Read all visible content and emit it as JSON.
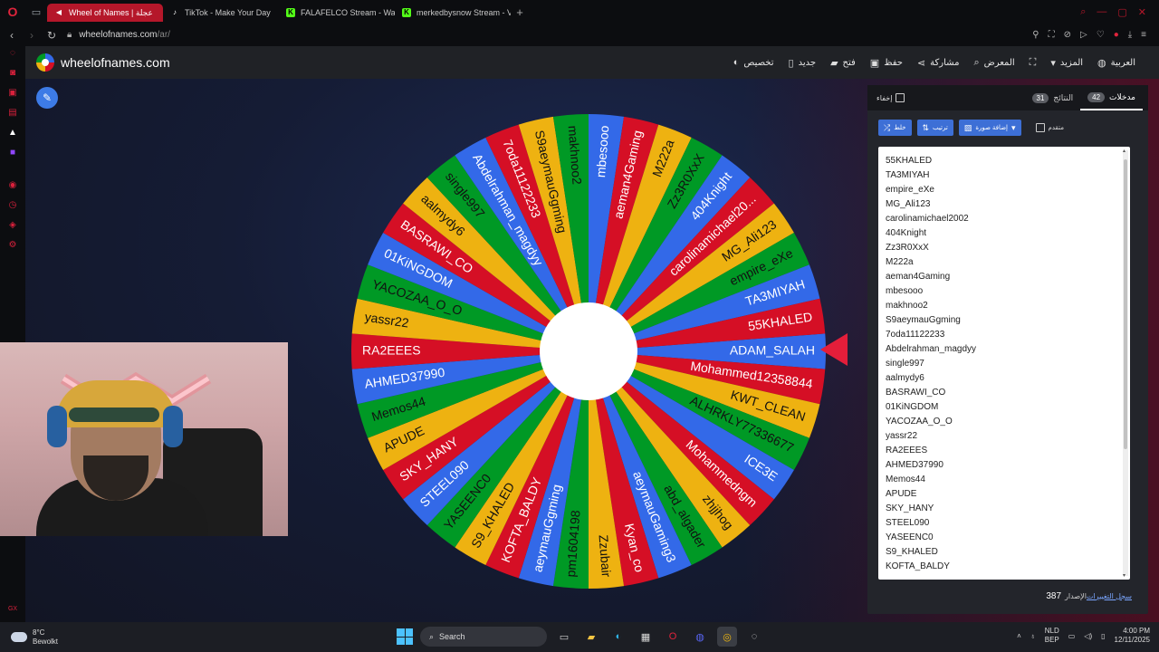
{
  "browser": {
    "tabs": [
      {
        "label": "Wheel of Names | عجلة",
        "active": true
      },
      {
        "label": "TikTok - Make Your Day",
        "active": false
      },
      {
        "label": "FALAFELCO Stream - Wa",
        "active": false
      },
      {
        "label": "merkedbysnow Stream - V",
        "active": false
      }
    ],
    "url_host": "wheelofnames.com",
    "url_path": "/ar/"
  },
  "site": {
    "brand": "wheelofnames.com",
    "menu": [
      {
        "label": "العربية",
        "icon": "globe-icon"
      },
      {
        "label": "المزيد",
        "icon": "caret-down-icon"
      },
      {
        "label": "",
        "icon": "fullscreen-icon"
      },
      {
        "label": "المعرض",
        "icon": "search-icon"
      },
      {
        "label": "مشاركة",
        "icon": "share-icon"
      },
      {
        "label": "حفظ",
        "icon": "save-icon"
      },
      {
        "label": "فتح",
        "icon": "folder-icon"
      },
      {
        "label": "جديد",
        "icon": "new-file-icon"
      },
      {
        "label": "تخصيص",
        "icon": "palette-icon"
      }
    ]
  },
  "panel": {
    "tabs": {
      "entries_label": "مدخلات",
      "entries_count": "42",
      "results_label": "النتائج",
      "results_count": "31",
      "hide_label": "إخفاء"
    },
    "toolbar": {
      "shuffle": "خلط",
      "sort": "ترتيب",
      "add_image": "إضافة صورة",
      "advanced": "متقدم"
    },
    "entries": [
      "55KHALED",
      "TA3MIYAH",
      "empire_eXe",
      "MG_Ali123",
      "carolinamichael2002",
      "404Knight",
      "Zz3R0XxX",
      "M222a",
      "aeman4Gaming",
      "mbesooo",
      "makhnoo2",
      "S9aeymauGgming",
      "7oda11122233",
      "Abdelrahman_magdyy",
      "single997",
      "aalmydy6",
      "BASRAWI_CO",
      "01KiNGDOM",
      "YACOZAA_O_O",
      "yassr22",
      "RA2EEES",
      "AHMED37990",
      "Memos44",
      "APUDE",
      "SKY_HANY",
      "STEEL090",
      "YASEENC0",
      "S9_KHALED",
      "KOFTA_BALDY"
    ],
    "version_label": "الإصدار",
    "version": "387",
    "changelog": "سجل التغييرات"
  },
  "wheel": {
    "colors": [
      "#3369e8",
      "#d50f25",
      "#eeb211",
      "#009925"
    ],
    "labels": [
      "ADAM_SALAH",
      "Mohammed12358844",
      "KWT_CLEAN",
      "ALHRKLY77336677",
      "ICE3E",
      "Mohammedngm",
      "zhjjhog",
      "abd_algader",
      "aeymauGaming3",
      "Kyan_co",
      "Zzubair",
      "pm1604198",
      "aeymauGgming",
      "KOFTA_BALDY",
      "S9_KHALED",
      "YASEENC0",
      "STEEL090",
      "SKY_HANY",
      "APUDE",
      "Memos44",
      "AHMED37990",
      "RA2EEES",
      "yassr22",
      "YACOZAA_O_O",
      "01KiNGDOM",
      "BASRAWI_CO",
      "aalmydy6",
      "single997",
      "Abdelrahman_magdyy",
      "7oda11122233",
      "S9aeymauGgming",
      "makhnoo2",
      "mbesooo",
      "aeman4Gaming",
      "M222a",
      "Zz3R0XxX",
      "404Knight",
      "carolinamichael20...",
      "MG_Ali123",
      "empire_eXe",
      "TA3MIYAH",
      "55KHALED"
    ]
  },
  "taskbar": {
    "temp": "8°C",
    "condition": "Bewolkt",
    "search": "Search",
    "lang_top": "NLD",
    "lang_bottom": "BEP",
    "time": "4:00 PM",
    "date": "12/11/2025"
  }
}
